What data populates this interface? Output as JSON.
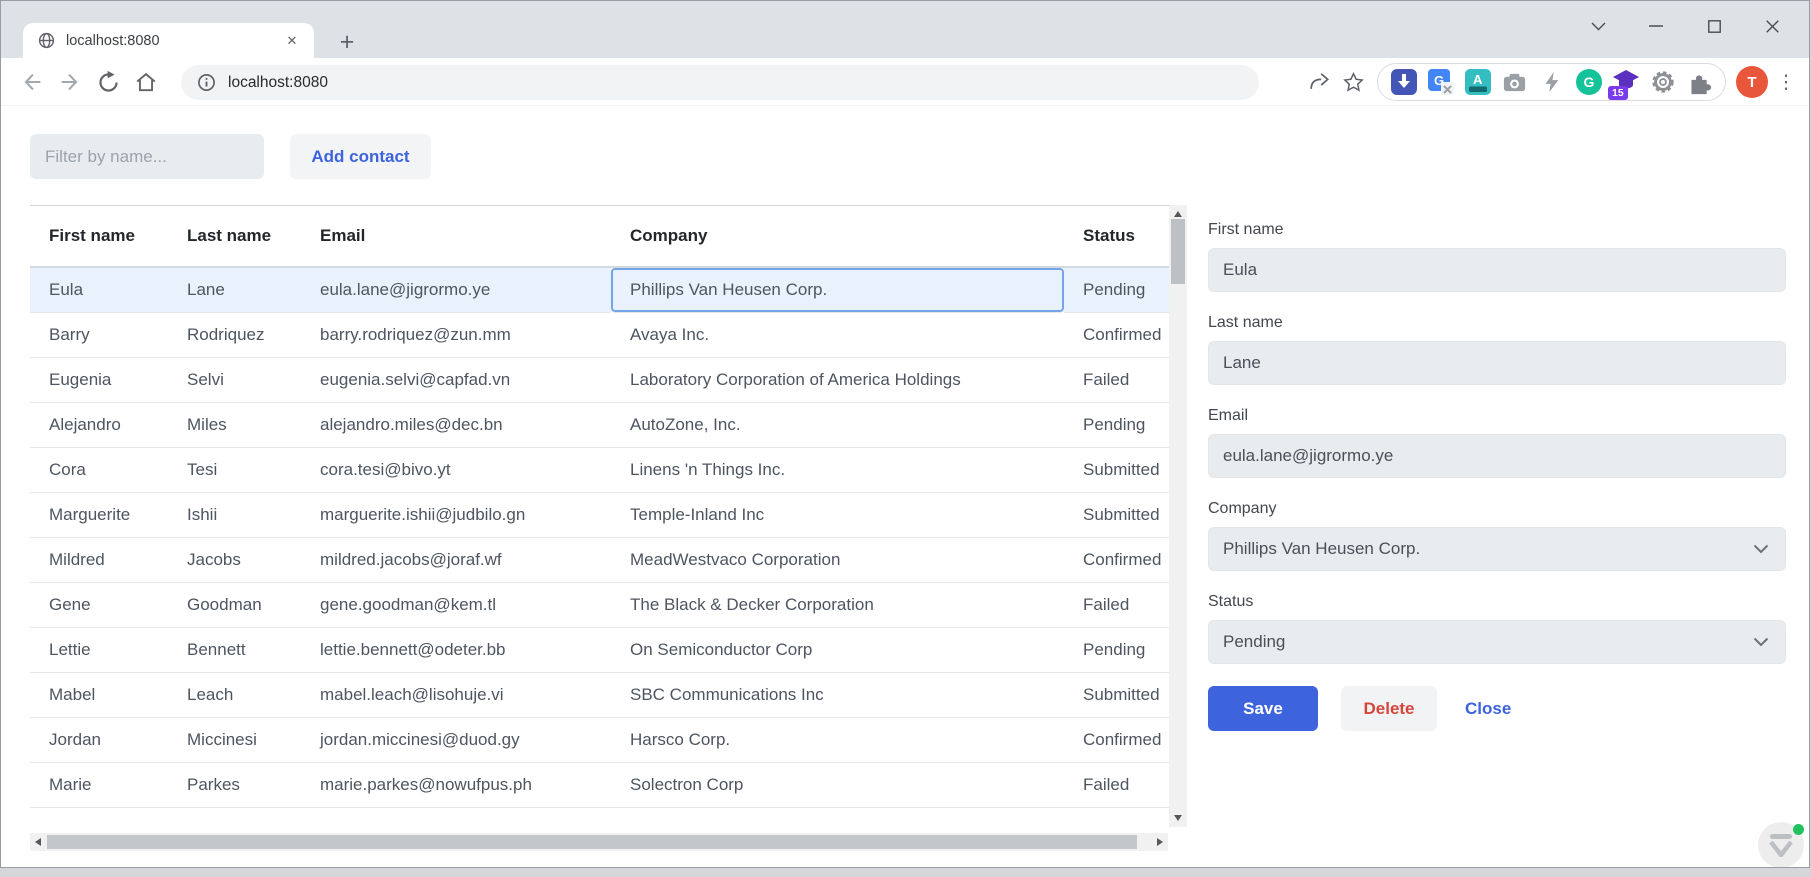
{
  "chrome": {
    "tab_title": "localhost:8080",
    "url": "localhost:8080",
    "profile_initial": "T",
    "extension_badge": "15",
    "icons": {
      "new_tab": "+",
      "kebab": "⋮",
      "tab_close": "✕"
    }
  },
  "page": {
    "filter_placeholder": "Filter by name...",
    "add_contact_label": "Add contact",
    "table": {
      "columns": [
        "First name",
        "Last name",
        "Email",
        "Company",
        "Status"
      ],
      "selected_row": 0,
      "selected_col": 3,
      "rows": [
        {
          "first": "Eula",
          "last": "Lane",
          "email": "eula.lane@jigrormo.ye",
          "company": "Phillips Van Heusen Corp.",
          "status": "Pending"
        },
        {
          "first": "Barry",
          "last": "Rodriquez",
          "email": "barry.rodriquez@zun.mm",
          "company": "Avaya Inc.",
          "status": "Confirmed"
        },
        {
          "first": "Eugenia",
          "last": "Selvi",
          "email": "eugenia.selvi@capfad.vn",
          "company": "Laboratory Corporation of America Holdings",
          "status": "Failed"
        },
        {
          "first": "Alejandro",
          "last": "Miles",
          "email": "alejandro.miles@dec.bn",
          "company": "AutoZone, Inc.",
          "status": "Pending"
        },
        {
          "first": "Cora",
          "last": "Tesi",
          "email": "cora.tesi@bivo.yt",
          "company": "Linens 'n Things Inc.",
          "status": "Submitted"
        },
        {
          "first": "Marguerite",
          "last": "Ishii",
          "email": "marguerite.ishii@judbilo.gn",
          "company": "Temple-Inland Inc",
          "status": "Submitted"
        },
        {
          "first": "Mildred",
          "last": "Jacobs",
          "email": "mildred.jacobs@joraf.wf",
          "company": "MeadWestvaco Corporation",
          "status": "Confirmed"
        },
        {
          "first": "Gene",
          "last": "Goodman",
          "email": "gene.goodman@kem.tl",
          "company": "The Black & Decker Corporation",
          "status": "Failed"
        },
        {
          "first": "Lettie",
          "last": "Bennett",
          "email": "lettie.bennett@odeter.bb",
          "company": "On Semiconductor Corp",
          "status": "Pending"
        },
        {
          "first": "Mabel",
          "last": "Leach",
          "email": "mabel.leach@lisohuje.vi",
          "company": "SBC Communications Inc",
          "status": "Submitted"
        },
        {
          "first": "Jordan",
          "last": "Miccinesi",
          "email": "jordan.miccinesi@duod.gy",
          "company": "Harsco Corp.",
          "status": "Confirmed"
        },
        {
          "first": "Marie",
          "last": "Parkes",
          "email": "marie.parkes@nowufpus.ph",
          "company": "Solectron Corp",
          "status": "Failed"
        }
      ]
    },
    "form": {
      "first_name_label": "First name",
      "first_name": "Eula",
      "last_name_label": "Last name",
      "last_name": "Lane",
      "email_label": "Email",
      "email": "eula.lane@jigrormo.ye",
      "company_label": "Company",
      "company": "Phillips Van Heusen Corp.",
      "status_label": "Status",
      "status": "Pending",
      "save_label": "Save",
      "delete_label": "Delete",
      "close_label": "Close"
    },
    "colors": {
      "accent_blue": "#3d63dd",
      "danger_red": "#d6453a",
      "selected_row_bg": "#e9f1fc",
      "selected_cell_border": "#76a4ea"
    }
  }
}
